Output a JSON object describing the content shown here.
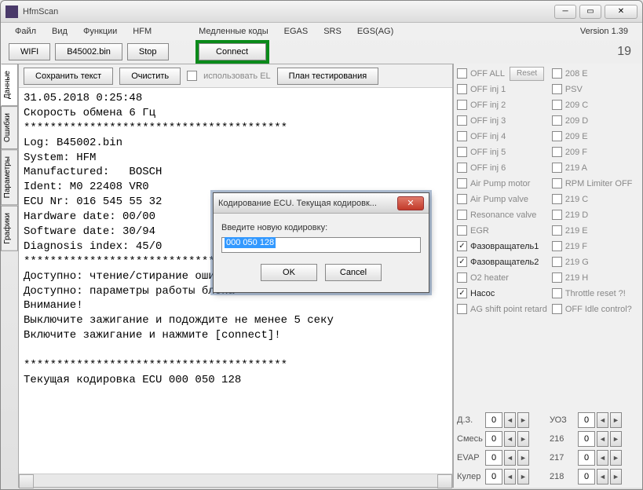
{
  "title": "HfmScan",
  "menu": [
    "Файл",
    "Вид",
    "Функции",
    "HFM",
    "Медленные коды",
    "EGAS",
    "SRS",
    "EGS(AG)"
  ],
  "version": "Version 1.39",
  "toolbar": {
    "wifi": "WIFI",
    "file": "B45002.bin",
    "stop": "Stop",
    "connect": "Connect",
    "counter": "19"
  },
  "vtabs": [
    "Данные",
    "Ошибки",
    "Параметры",
    "Графики"
  ],
  "ctrls": {
    "save": "Сохранить текст",
    "clear": "Очистить",
    "useEL": "использовать EL",
    "plan": "План тестирования"
  },
  "log": "31.05.2018 0:25:48\nСкорость обмена 6 Гц\n****************************************\nLog: B45002.bin\nSystem: HFM\nManufactured:   BOSCH\nIdent: M0 22408 VR0\nECU Nr: 016 545 55 32\nHardware date: 00/00 \nSoftware date: 30/94 \nDiagnosis index: 45/0\n****************************************\nДоступно: чтение/стирание ошибок\nДоступно: параметры работы блока\nВнимание!\nВыключите зажигание и подождите не менее 5 секу\nВключите зажигание и нажмите [connect]!\n\n****************************************\nТекущая кодировка ECU 000 050 128",
  "left_checks": [
    {
      "label": "OFF ALL",
      "on": false,
      "btn": "Reset"
    },
    {
      "label": "OFF inj 1",
      "on": false
    },
    {
      "label": "OFF inj 2",
      "on": false
    },
    {
      "label": "OFF inj 3",
      "on": false
    },
    {
      "label": "OFF inj 4",
      "on": false
    },
    {
      "label": "OFF inj 5",
      "on": false
    },
    {
      "label": "OFF inj 6",
      "on": false
    },
    {
      "label": "Air Pump motor",
      "on": false
    },
    {
      "label": "Air Pump valve",
      "on": false
    },
    {
      "label": "Resonance valve",
      "on": false
    },
    {
      "label": "EGR",
      "on": false
    },
    {
      "label": "Фазовращатель1",
      "on": true
    },
    {
      "label": "Фазовращатель2",
      "on": true
    },
    {
      "label": "O2 heater",
      "on": false
    },
    {
      "label": "Насос",
      "on": true
    },
    {
      "label": "AG shift point retard",
      "on": false
    }
  ],
  "right_checks": [
    {
      "label": "208 E",
      "on": false
    },
    {
      "label": "PSV",
      "on": false
    },
    {
      "label": "209 C",
      "on": false
    },
    {
      "label": "209 D",
      "on": false
    },
    {
      "label": "209 E",
      "on": false
    },
    {
      "label": "209 F",
      "on": false
    },
    {
      "label": "219 A",
      "on": false
    },
    {
      "label": "RPM Limiter OFF",
      "on": false
    },
    {
      "label": "219 C",
      "on": false
    },
    {
      "label": "219 D",
      "on": false
    },
    {
      "label": "219 E",
      "on": false
    },
    {
      "label": "219 F",
      "on": false
    },
    {
      "label": "219 G",
      "on": false
    },
    {
      "label": "219 H",
      "on": false
    },
    {
      "label": "Throttle reset ?!",
      "on": false
    },
    {
      "label": "OFF Idle control?",
      "on": false
    }
  ],
  "spinners": [
    [
      {
        "lbl": "Д.З.",
        "val": "0"
      },
      {
        "lbl": "УОЗ",
        "val": "0"
      }
    ],
    [
      {
        "lbl": "Смесь",
        "val": "0"
      },
      {
        "lbl": "216",
        "val": "0"
      }
    ],
    [
      {
        "lbl": "EVAP",
        "val": "0"
      },
      {
        "lbl": "217",
        "val": "0"
      }
    ],
    [
      {
        "lbl": "Кулер",
        "val": "0"
      },
      {
        "lbl": "218",
        "val": "0"
      }
    ]
  ],
  "dialog": {
    "title": "Кодирование ECU. Текущая кодировк...",
    "label": "Введите новую кодировку:",
    "value": "000 050 128",
    "ok": "OK",
    "cancel": "Cancel"
  }
}
